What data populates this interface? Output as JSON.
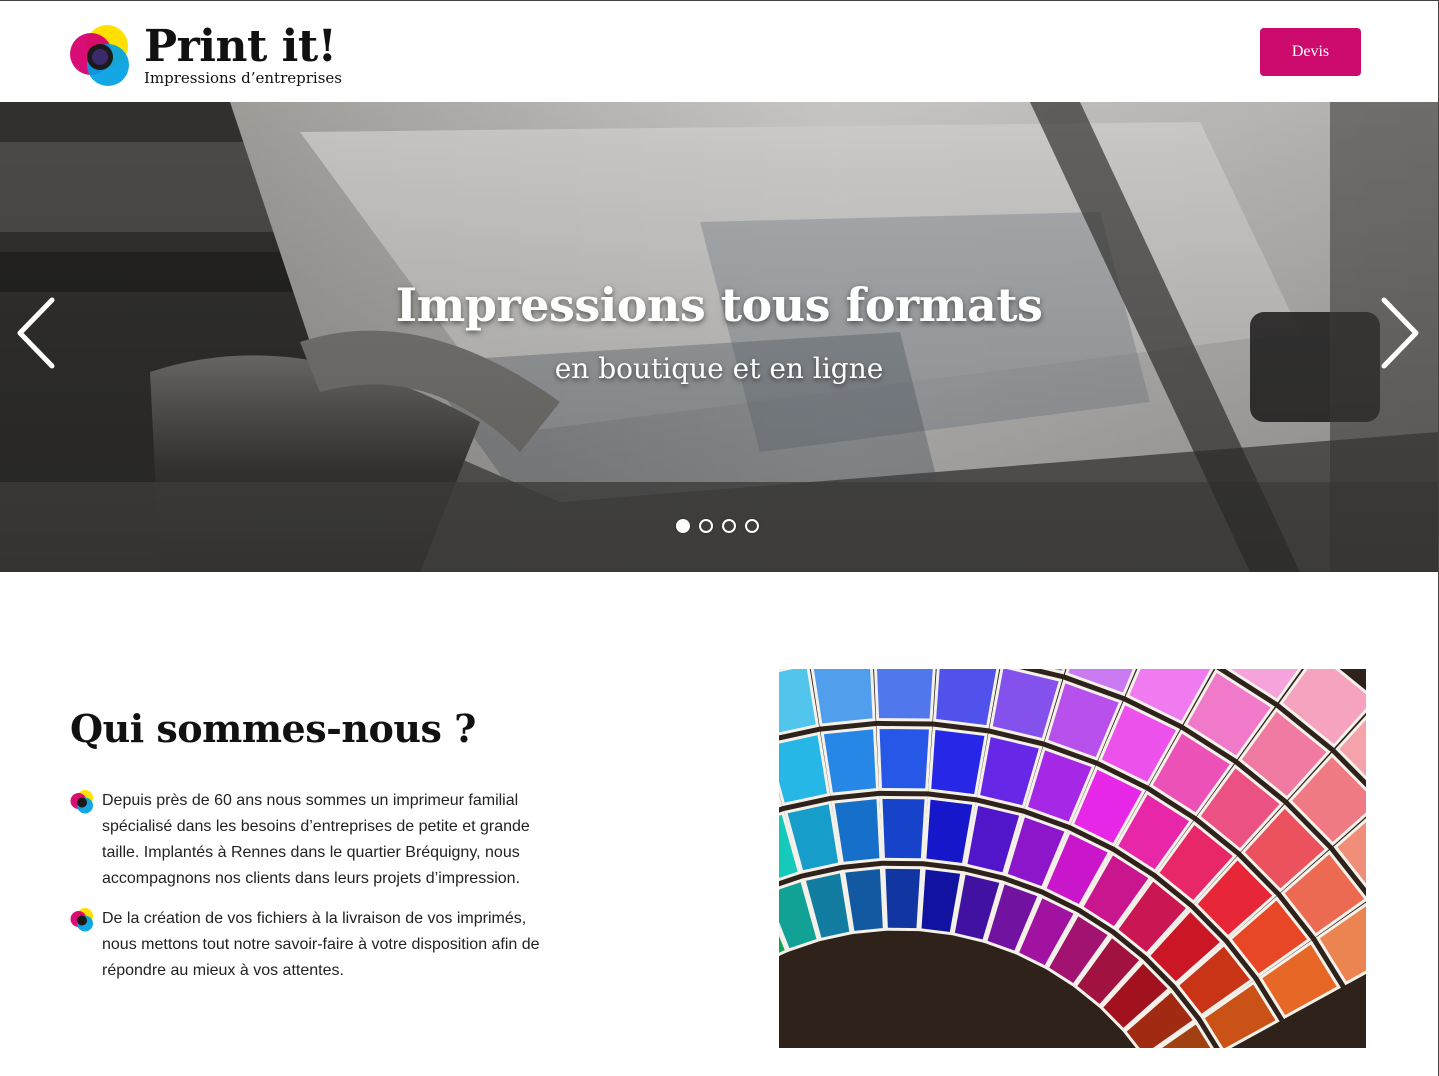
{
  "header": {
    "logo_title": "Print it!",
    "logo_subtitle": "Impressions d’entreprises",
    "cta_label": "Devis"
  },
  "hero": {
    "title": "Impressions tous formats",
    "subtitle": "en boutique et en ligne",
    "prev_icon": "chevron-left-icon",
    "next_icon": "chevron-right-icon",
    "slides": 4,
    "active_slide": 1
  },
  "about": {
    "title": "Qui sommes-nous ?",
    "items": [
      "Depuis près de 60 ans nous sommes un imprimeur familial spécialisé dans les besoins d’entreprises de petite et grande taille. Implantés à Rennes dans le quartier Bréquigny, nous accompagnons nos clients dans leurs projets d’impression.",
      "De la création de vos fichiers à la livraison de vos imprimés, nous mettons tout notre savoir-faire à votre disposition afin de répondre au mieux à vos attentes."
    ]
  },
  "colors": {
    "accent": "#cc0b6c",
    "cmyk_magenta": "#d6006e",
    "cmyk_yellow": "#ffe000",
    "cmyk_cyan": "#009fe3",
    "cmyk_black": "#1a1a1a"
  }
}
